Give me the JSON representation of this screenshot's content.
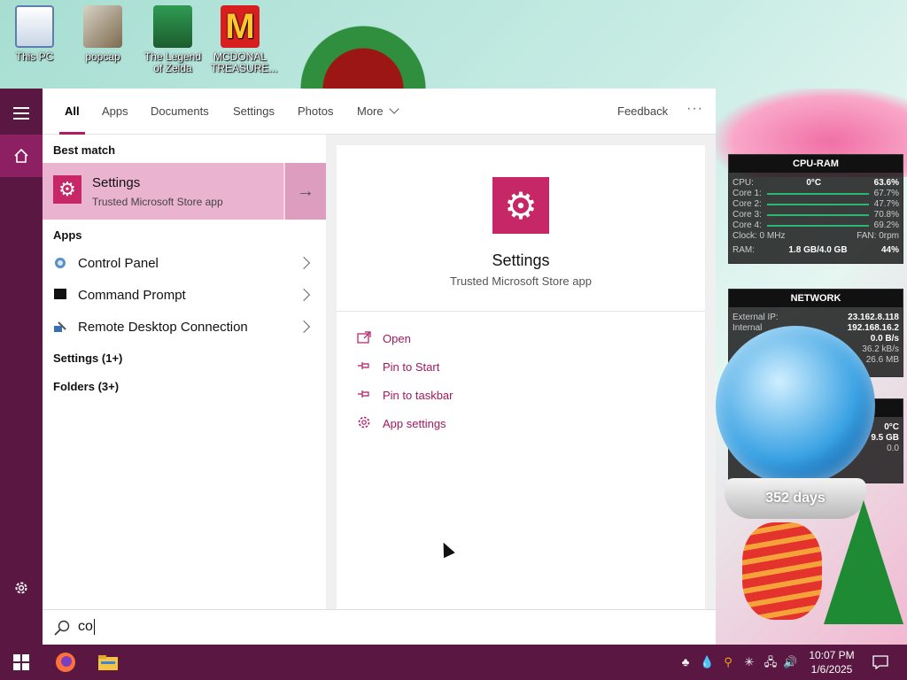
{
  "desktop": {
    "icons": [
      {
        "label": "This PC"
      },
      {
        "label": "popcap"
      },
      {
        "label": "The Legend of Zelda"
      },
      {
        "label": "MCDONAL TREASURE..."
      }
    ]
  },
  "widgets": {
    "cpu_ram": {
      "title": "CPU-RAM",
      "cpu_label": "CPU:",
      "cpu_temp": "0°C",
      "cpu_val": "63.6%",
      "cores": [
        {
          "label": "Core 1:",
          "val": "67.7%"
        },
        {
          "label": "Core 2:",
          "val": "47.7%"
        },
        {
          "label": "Core 3:",
          "val": "70.8%"
        },
        {
          "label": "Core 4:",
          "val": "69.2%"
        }
      ],
      "clock_label": "Clock: 0 MHz",
      "fan_label": "FAN: 0rpm",
      "ram_label": "RAM:",
      "ram_usage": "1.8 GB/4.0 GB",
      "ram_val": "44%"
    },
    "network": {
      "title": "NETWORK",
      "ext_label": "External IP:",
      "ext_val": "23.162.8.118",
      "int_label": "Internal",
      "int_val": "192.168.16.2",
      "rows": [
        "0.0 B/s",
        "36.2 kB/s",
        "26.6 MB"
      ]
    },
    "third": {
      "temp": "0°C",
      "size": "9.5 GB",
      "val": "0.0"
    },
    "globe_text": "352 days"
  },
  "search": {
    "tabs": [
      {
        "label": "All"
      },
      {
        "label": "Apps"
      },
      {
        "label": "Documents"
      },
      {
        "label": "Settings"
      },
      {
        "label": "Photos"
      },
      {
        "label": "More"
      }
    ],
    "feedback": "Feedback",
    "ellipsis": "···",
    "best_match_title": "Best match",
    "best_match": {
      "title": "Settings",
      "subtitle": "Trusted Microsoft Store app"
    },
    "apps_title": "Apps",
    "apps": [
      {
        "label": "Control Panel"
      },
      {
        "label": "Command Prompt"
      },
      {
        "label": "Remote Desktop Connection"
      }
    ],
    "groups": [
      "Settings (1+)",
      "Folders (3+)"
    ],
    "preview": {
      "title": "Settings",
      "subtitle": "Trusted Microsoft Store app",
      "actions": [
        {
          "label": "Open"
        },
        {
          "label": "Pin to Start"
        },
        {
          "label": "Pin to taskbar"
        },
        {
          "label": "App settings"
        }
      ]
    },
    "query": "co"
  },
  "taskbar": {
    "time": "10:07 PM",
    "date": "1/6/2025"
  },
  "colors": {
    "accent": "#b01b66",
    "rail": "#5a1742",
    "best_match_bg": "#eab3d0"
  }
}
